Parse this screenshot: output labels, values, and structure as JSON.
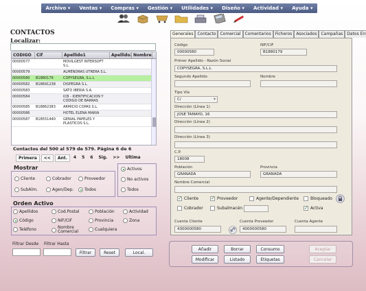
{
  "menu": [
    "Archivo ▾",
    "Ventas ▾",
    "Compras ▾",
    "Gestión ▾",
    "Utilidades ▾",
    "Diseño ▾",
    "Actividad ▾",
    "Ayuda ▾"
  ],
  "toolbar_icons": [
    "users-icon",
    "box-icon",
    "shopping-cart-icon",
    "folder-icon",
    "cash-register-icon",
    "calculator-icon",
    "pen-icon"
  ],
  "left": {
    "title": "CONTACTOS",
    "search_label": "Localizar:",
    "search_value": "",
    "columns": [
      "CODIGO",
      "Cif",
      "Apellido1",
      "Apellido2",
      "Nombre"
    ],
    "rows": [
      {
        "codigo": "00000577",
        "cif": "",
        "apellido1": "MOVILGEST INTERSOFT S.L.",
        "apellido2": "",
        "nombre": ""
      },
      {
        "codigo": "00000579",
        "cif": "",
        "apellido1": "ALMENDRAS UTRERA S.L.",
        "apellido2": "",
        "nombre": ""
      },
      {
        "codigo": "00000580",
        "cif": "B1880179",
        "apellido1": "COPYSEGRA, S.L.L",
        "apellido2": "",
        "nombre": ""
      },
      {
        "codigo": "00000582",
        "cif": "B18691238",
        "apellido1": "DISPEGRA S.L.",
        "apellido2": "",
        "nombre": ""
      },
      {
        "codigo": "00000583",
        "cif": "",
        "apellido1": "SATO IBERIA S.A.",
        "apellido2": "",
        "nombre": ""
      },
      {
        "codigo": "00000584",
        "cif": "",
        "apellido1": "ICB - IDENTIFICACION Y CODIGO DE BARRAS",
        "apellido2": "",
        "nombre": ""
      },
      {
        "codigo": "00000585",
        "cif": "B18862383",
        "apellido1": "ARMICIO COPAS S.L.",
        "apellido2": "",
        "nombre": ""
      },
      {
        "codigo": "00000586",
        "cif": "",
        "apellido1": "HOTEL ELENA MARIA",
        "apellido2": "",
        "nombre": ""
      },
      {
        "codigo": "00000587",
        "cif": "B18551440",
        "apellido1": "GENIAL PAPELES Y PLASTICOS S.L.",
        "apellido2": "",
        "nombre": ""
      }
    ],
    "selected_row": 2,
    "summary": "Contactos del 500 al 579 de 579. Página 6 de 6",
    "pager": [
      "Primera",
      "<<",
      "Ant.",
      "4",
      "5",
      "6",
      "Sig.",
      ">>",
      "Ultima"
    ],
    "mostrar": {
      "title": "Mostrar",
      "options": [
        "Cliente",
        "Cobrador",
        "Proveedor",
        "SubAlm.",
        "Agen/Dep.",
        "Todos"
      ],
      "selected": 5,
      "estado": [
        "Activos",
        "No activos",
        "Todos"
      ],
      "estado_selected": 0
    },
    "orden": {
      "title": "Orden Activo",
      "options": [
        "Apellidos",
        "Cod.Postal",
        "Población",
        "Actividad",
        "Código",
        "NIF/CIF",
        "Provincia",
        "Zona",
        "Teléfono",
        "Nombre Comercial",
        "Cualquiera"
      ],
      "selected": 4
    },
    "filtro_desde_label": "Filtrar Desde",
    "filtro_hasta_label": "Filtrar Hasta",
    "buttons": {
      "filtrar": "Filtrar",
      "reset": "Reset",
      "local": "Local."
    }
  },
  "right": {
    "tabs": [
      "Generales",
      "Contacto",
      "Comercial",
      "Comentarios",
      "Ficheros",
      "Asociados",
      "Campañas",
      "Datos Envío"
    ],
    "active_tab": 0,
    "fields": {
      "codigo_label": "Código",
      "codigo": "00000580",
      "nif_label": "NIF/CIF",
      "nif": "B1880179",
      "apellido1_label": "Primer Apellido - Razón Social",
      "apellido1": "COPYSEGRA, S.L.L",
      "apellido2_label": "Segundo Apellido",
      "apellido2": "",
      "nombre_label": "Nombre",
      "nombre": "",
      "tipovia_label": "Tipo Vía",
      "tipovia": "C/",
      "dir1_label": "Dirección (Línea 1)",
      "dir1": "JOSE TAMAYO, 16",
      "dir2_label": "Dirección (Línea 2)",
      "dir2": "",
      "dir3_label": "Dirección (Línea 3)",
      "dir3": "",
      "cp_label": "C.P.",
      "cp": "18008",
      "poblacion_label": "Población",
      "poblacion": "GRANADA",
      "provincia_label": "Provincia",
      "provincia": "GRANADA",
      "comercial_label": "Nombre Comercial",
      "comercial": "",
      "cuenta_cliente_label": "Cuenta Cliente",
      "cuenta_cliente": "4300000580",
      "cuenta_proveedor_label": "Cuenta Proveedor",
      "cuenta_proveedor": "4000000580",
      "cuenta_agente_label": "Cuenta Agente",
      "cuenta_agente": ""
    },
    "checks": {
      "cliente": {
        "label": "Cliente",
        "checked": true
      },
      "proveedor": {
        "label": "Proveedor",
        "checked": true
      },
      "agente": {
        "label": "Agente/Dependiente",
        "checked": false
      },
      "bloqueado": {
        "label": "Bloqueado",
        "checked": false
      },
      "cobrador": {
        "label": "Cobrador",
        "checked": false
      },
      "subalmacen": {
        "label": "Subalmacén",
        "checked": false
      },
      "activa": {
        "label": "Activa",
        "checked": true
      }
    },
    "buttons": {
      "anadir": "Añadir",
      "borrar": "Borrar",
      "consumo": "Consumo",
      "aceptar": "Aceptar",
      "modificar": "Modificar",
      "listado": "Listado",
      "etiquetas": "Etiquetas",
      "cancelar": "Cancelar"
    }
  }
}
